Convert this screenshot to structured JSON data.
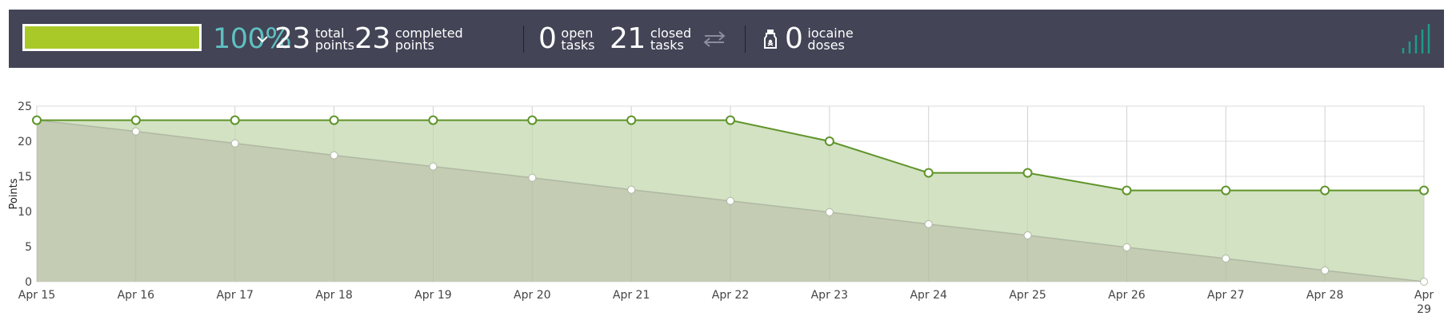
{
  "summary": {
    "progress_percent": 100,
    "percent_label": "100%",
    "total_points_value": "23",
    "total_points_label_1": "total",
    "total_points_label_2": "points",
    "completed_points_value": "23",
    "completed_points_label_1": "completed",
    "completed_points_label_2": "points",
    "open_tasks_value": "0",
    "open_tasks_label_1": "open",
    "open_tasks_label_2": "tasks",
    "closed_tasks_value": "21",
    "closed_tasks_label_1": "closed",
    "closed_tasks_label_2": "tasks",
    "iocaine_value": "0",
    "iocaine_label_1": "iocaine",
    "iocaine_label_2": "doses"
  },
  "icons": {
    "toggle": "chevron-down-icon",
    "swap": "swap-arrows-icon",
    "iocaine": "potion-bottle-icon",
    "graph": "bar-graph-icon"
  },
  "colors": {
    "topbar_bg": "#434456",
    "progress_fill": "#a9c928",
    "percent_text": "#5ec0c0",
    "graph_icon": "#1e9a8c",
    "actual_line": "#5f9429",
    "actual_fill": "#d0e0bf",
    "ideal_fill": "#c3cab3",
    "ideal_line": "#b0b8a4"
  },
  "chart_data": {
    "type": "area",
    "ylabel": "Points",
    "ylim": [
      0,
      25
    ],
    "yticks": [
      0,
      5,
      10,
      15,
      20,
      25
    ],
    "grid": true,
    "x": [
      "Apr 15",
      "Apr 16",
      "Apr 17",
      "Apr 18",
      "Apr 19",
      "Apr 20",
      "Apr 21",
      "Apr 22",
      "Apr 23",
      "Apr 24",
      "Apr 25",
      "Apr 26",
      "Apr 27",
      "Apr 28",
      "Apr 29"
    ],
    "x_tick_labels": [
      [
        "Apr 15"
      ],
      [
        "Apr 16"
      ],
      [
        "Apr 17"
      ],
      [
        "Apr 18"
      ],
      [
        "Apr 19"
      ],
      [
        "Apr 20"
      ],
      [
        "Apr 21"
      ],
      [
        "Apr 22"
      ],
      [
        "Apr 23"
      ],
      [
        "Apr 24"
      ],
      [
        "Apr 25"
      ],
      [
        "Apr 26"
      ],
      [
        "Apr 27"
      ],
      [
        "Apr 28"
      ],
      [
        "Apr",
        "29"
      ]
    ],
    "series": [
      {
        "values": [
          23,
          23,
          23,
          23,
          23,
          23,
          23,
          23,
          20,
          15.5,
          15.5,
          13,
          13,
          13,
          13
        ]
      },
      {
        "values": [
          23,
          21.4,
          19.7,
          18,
          16.4,
          14.8,
          13.1,
          11.5,
          9.9,
          8.2,
          6.6,
          4.9,
          3.3,
          1.6,
          0
        ]
      }
    ]
  }
}
